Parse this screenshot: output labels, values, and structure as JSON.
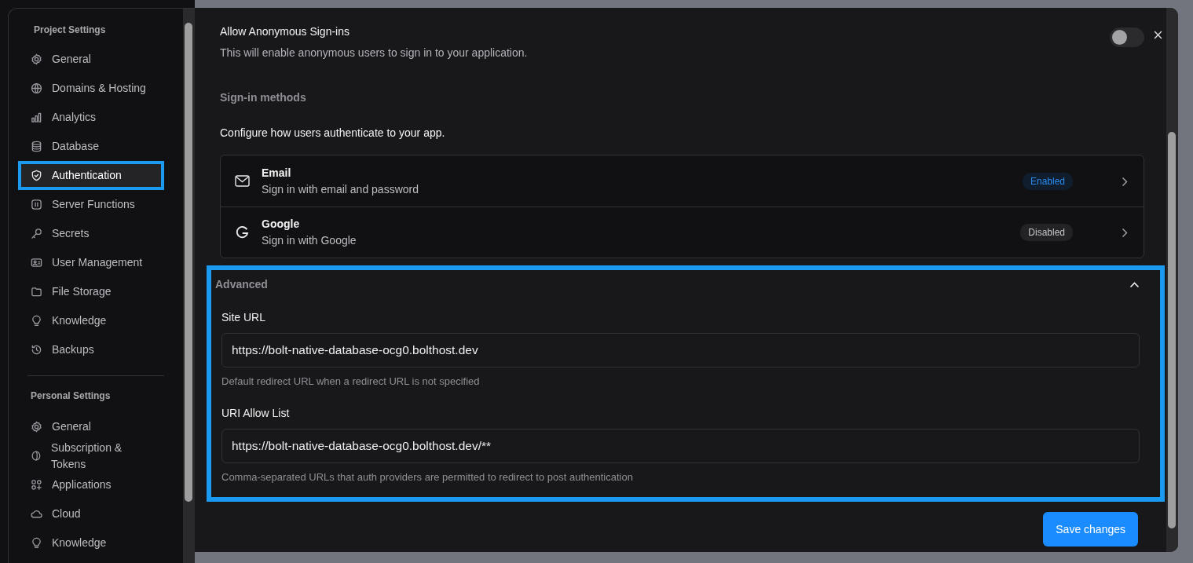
{
  "sidebar": {
    "sections": [
      {
        "heading": "Project Settings",
        "items": [
          {
            "label": "General",
            "selected": false,
            "highlighted": false
          },
          {
            "label": "Domains & Hosting",
            "selected": false,
            "highlighted": false
          },
          {
            "label": "Analytics",
            "selected": false,
            "highlighted": false
          },
          {
            "label": "Database",
            "selected": false,
            "highlighted": false
          },
          {
            "label": "Authentication",
            "selected": true,
            "highlighted": true
          },
          {
            "label": "Server Functions",
            "selected": false,
            "highlighted": false
          },
          {
            "label": "Secrets",
            "selected": false,
            "highlighted": false
          },
          {
            "label": "User Management",
            "selected": false,
            "highlighted": false
          },
          {
            "label": "File Storage",
            "selected": false,
            "highlighted": false
          },
          {
            "label": "Knowledge",
            "selected": false,
            "highlighted": false
          },
          {
            "label": "Backups",
            "selected": false,
            "highlighted": false
          }
        ]
      },
      {
        "heading": "Personal Settings",
        "items": [
          {
            "label": "General",
            "selected": false,
            "highlighted": false
          },
          {
            "label": "Subscription & Tokens",
            "selected": false,
            "highlighted": false
          },
          {
            "label": "Applications",
            "selected": false,
            "highlighted": false
          },
          {
            "label": "Cloud",
            "selected": false,
            "highlighted": false
          },
          {
            "label": "Knowledge",
            "selected": false,
            "highlighted": false
          }
        ]
      }
    ]
  },
  "settings": {
    "anonymous": {
      "title": "Allow Anonymous Sign-ins",
      "description": "This will enable anonymous users to sign in to your application.",
      "on": false
    },
    "methods": {
      "heading": "Sign-in methods",
      "description": "Configure how users authenticate to your app.",
      "providers": [
        {
          "name": "Email",
          "description": "Sign in with email and password",
          "status": "Enabled",
          "enabled": true
        },
        {
          "name": "Google",
          "description": "Sign in with Google",
          "status": "Disabled",
          "enabled": false
        }
      ]
    },
    "advanced": {
      "title": "Advanced",
      "expanded": true,
      "highlighted": true,
      "fields": [
        {
          "label": "Site URL",
          "value": "https://bolt-native-database-ocg0.bolthost.dev",
          "help": "Default redirect URL when a redirect URL is not specified"
        },
        {
          "label": "URI Allow List",
          "value": "https://bolt-native-database-ocg0.bolthost.dev/**",
          "help": "Comma-separated URLs that auth providers are permitted to redirect to post authentication"
        }
      ]
    },
    "save_button": "Save changes"
  }
}
